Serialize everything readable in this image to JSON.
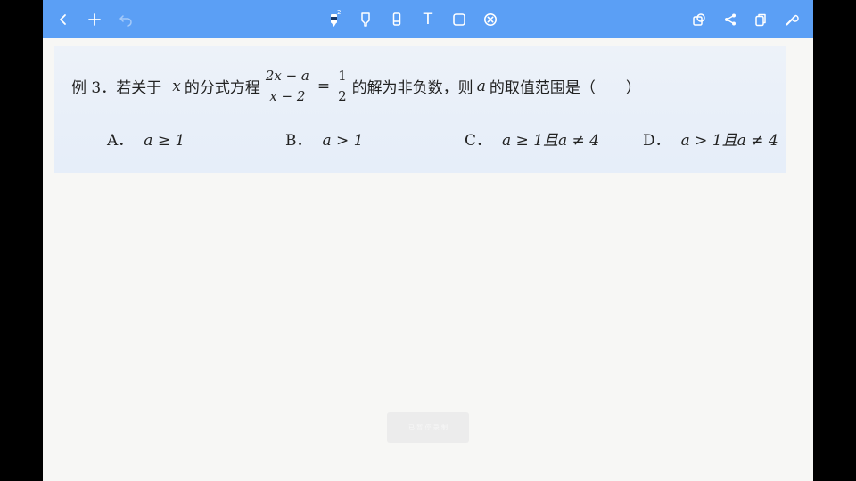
{
  "toolbar": {
    "left": [
      {
        "name": "back",
        "icon": "chevron-left-icon"
      },
      {
        "name": "add",
        "icon": "plus-icon"
      },
      {
        "name": "undo",
        "icon": "undo-icon",
        "disabled": true
      }
    ],
    "center": [
      {
        "name": "pen",
        "icon": "pen-icon",
        "badge": "2"
      },
      {
        "name": "highlighter",
        "icon": "highlighter-icon"
      },
      {
        "name": "eraser",
        "icon": "eraser-icon"
      },
      {
        "name": "text",
        "icon": "text-tool-icon",
        "glyph": "T"
      },
      {
        "name": "shape",
        "icon": "square-shape-icon"
      },
      {
        "name": "lasso",
        "icon": "circle-x-icon"
      }
    ],
    "right": [
      {
        "name": "layers",
        "icon": "layers-icon"
      },
      {
        "name": "share",
        "icon": "share-icon"
      },
      {
        "name": "copy",
        "icon": "copy-icon"
      },
      {
        "name": "settings",
        "icon": "wrench-icon"
      }
    ],
    "accent_color": "#5b9ff5"
  },
  "question": {
    "prefix": "例 3．若关于",
    "var_x": "x",
    "mid": "的分式方程",
    "frac1_num": "2x − a",
    "frac1_den": "x − 2",
    "equals": "=",
    "frac2_num": "1",
    "frac2_den": "2",
    "after_eq": "的解为非负数，则",
    "var_a": "a",
    "suffix": "的取值范围是（",
    "paren_close": "）"
  },
  "choices": [
    {
      "label": "A．",
      "expr": "a ≥ 1"
    },
    {
      "label": "B．",
      "expr": "a > 1"
    },
    {
      "label": "C．",
      "expr": "a ≥ 1且a ≠ 4"
    },
    {
      "label": "D．",
      "expr": "a > 1且a ≠ 4"
    }
  ],
  "watermark": {
    "text": "已 暂 停 录 制"
  }
}
